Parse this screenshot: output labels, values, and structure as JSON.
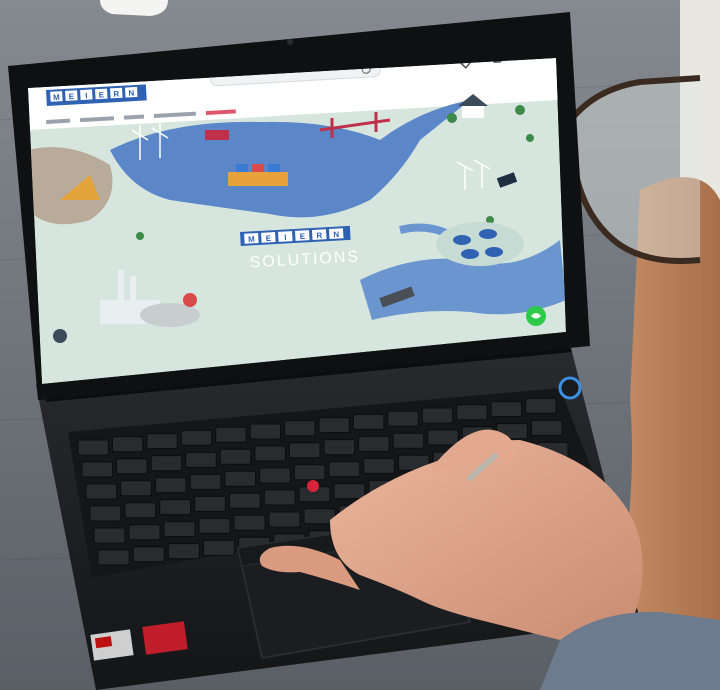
{
  "photo": {
    "kind": "photo of a person using a laptop showing a website",
    "colors": {
      "background_top": "#8a8f95",
      "background_bottom": "#5c6168",
      "laptop_body": "#1e1f22",
      "laptop_bezel": "#101113",
      "screen_land": "#d6e6df",
      "screen_water": "#5b86c7",
      "screen_water_light": "#7da6d8",
      "brand_blue": "#2f62b3",
      "whatsapp_green": "#2ecb4a",
      "trackpoint_red": "#d6243a",
      "skin": "#e0a58c",
      "glasses_frame": "#3a2a20"
    }
  },
  "website": {
    "logo_letters": [
      "M",
      "E",
      "I",
      "E",
      "R",
      "N"
    ],
    "hero_logo_letters": [
      "M",
      "E",
      "I",
      "E",
      "R",
      "N"
    ],
    "hero_subtitle": "SOLUTIONS"
  },
  "icons": [
    "heart-icon",
    "user-icon",
    "cart-icon",
    "search-icon",
    "whatsapp-icon",
    "info-icon",
    "power-button-icon",
    "trackpoint-icon"
  ]
}
